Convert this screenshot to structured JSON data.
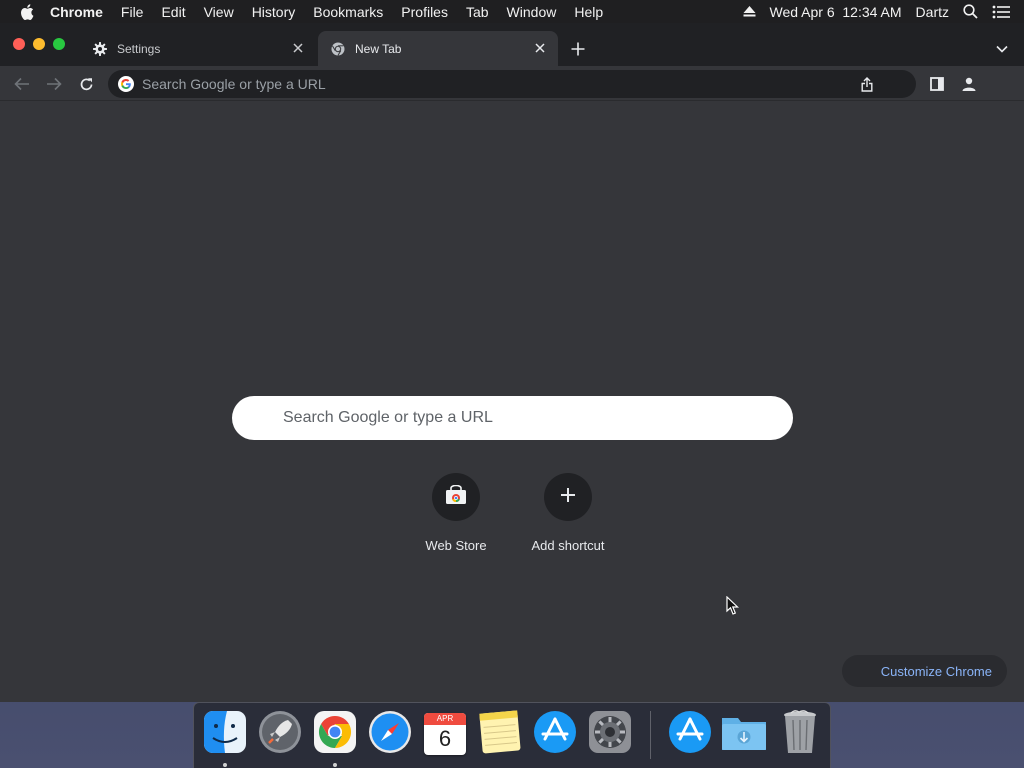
{
  "menubar": {
    "app_name": "Chrome",
    "items": [
      "File",
      "Edit",
      "View",
      "History",
      "Bookmarks",
      "Profiles",
      "Tab",
      "Window",
      "Help"
    ],
    "clock": "Wed Apr 6  12:34 AM",
    "user": "Dartz"
  },
  "tabs": [
    {
      "label": "Settings",
      "icon": "gear-icon",
      "active": false
    },
    {
      "label": "New Tab",
      "icon": "chrome-icon",
      "active": true
    }
  ],
  "omnibox": {
    "placeholder": "Search Google or type a URL"
  },
  "ntp": {
    "search_placeholder": "Search Google or type a URL",
    "shortcuts": [
      {
        "label": "Web Store",
        "icon": "web-store-icon"
      },
      {
        "label": "Add shortcut",
        "icon": "plus-icon"
      }
    ],
    "customize_label": "Customize Chrome"
  },
  "dock": {
    "apps": [
      {
        "name": "Finder",
        "icon": "finder-icon",
        "running": true
      },
      {
        "name": "Launchpad",
        "icon": "launchpad-icon",
        "running": false
      },
      {
        "name": "Google Chrome",
        "icon": "chrome-icon",
        "running": true
      },
      {
        "name": "Safari",
        "icon": "safari-icon",
        "running": false
      },
      {
        "name": "Calendar",
        "icon": "calendar-icon",
        "running": false,
        "month": "APR",
        "day": "6"
      },
      {
        "name": "Notes",
        "icon": "notes-icon",
        "running": false
      },
      {
        "name": "App Store",
        "icon": "app-store-icon",
        "running": false
      },
      {
        "name": "System Preferences",
        "icon": "system-preferences-icon",
        "running": false
      },
      {
        "name": "App Store",
        "icon": "app-store-icon",
        "running": false
      },
      {
        "name": "Downloads",
        "icon": "downloads-folder-icon",
        "running": false
      },
      {
        "name": "Trash",
        "icon": "trash-icon",
        "running": false
      }
    ]
  },
  "colors": {
    "window_bg": "#35363a",
    "tabstrip_bg": "#202124",
    "accent_link": "#8ab4f8"
  }
}
